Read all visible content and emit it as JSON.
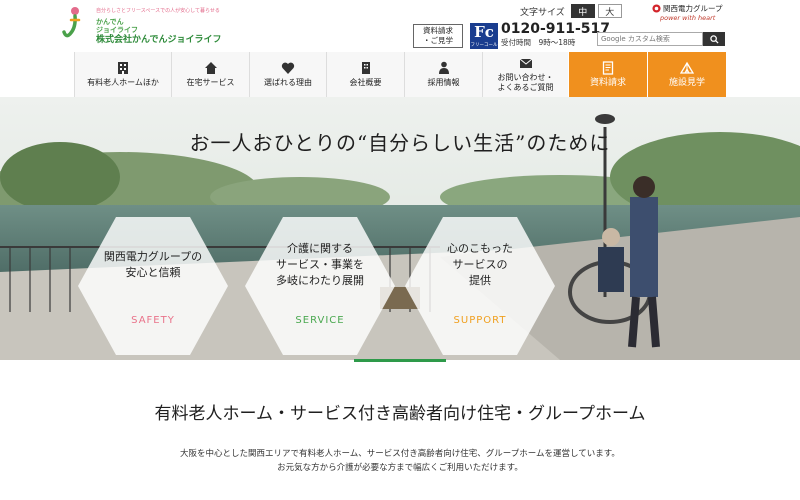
{
  "logo": {
    "tagline": "自分らしさとフリースペースでの人が安心して暮らせる",
    "brand": "かんでん\nジョイライフ",
    "company": "株式会社かんでんジョイライフ"
  },
  "font_size": {
    "label": "文字サイズ",
    "options": [
      "中",
      "大"
    ],
    "selected": "中"
  },
  "kepco": {
    "name": "関西電力グループ",
    "slogan": "power with heart"
  },
  "document_request_small": "資料請求\n・ご見学",
  "freecall": {
    "badge": "Fc",
    "badge_sub": "フリーコール",
    "number": "0120-911-517",
    "hours": "受付時間　9時～18時"
  },
  "search": {
    "placeholder": "Google カスタム検索",
    "button_icon": "search-icon"
  },
  "nav": [
    {
      "label": "有料老人ホームほか",
      "icon": "building-icon"
    },
    {
      "label": "在宅サービス",
      "icon": "home-icon"
    },
    {
      "label": "選ばれる理由",
      "icon": "heart-icon"
    },
    {
      "label": "会社概要",
      "icon": "office-icon"
    },
    {
      "label": "採用情報",
      "icon": "person-icon"
    },
    {
      "label": "お問い合わせ・\nよくあるご質問",
      "icon": "mail-icon"
    },
    {
      "label": "資料請求",
      "icon": "document-icon"
    },
    {
      "label": "施設見学",
      "icon": "tent-icon"
    }
  ],
  "hero": {
    "headline": "お一人おひとりの“自分らしい生活”のために",
    "hexagons": [
      {
        "text": "関西電力グループの\n安心と信頼",
        "en": "SAFETY",
        "color": "#e9738a"
      },
      {
        "text": "介護に関する\nサービス・事業を\n多岐にわたり展開",
        "en": "SERVICE",
        "color": "#4aa84f"
      },
      {
        "text": "心のこもった\nサービスの\n提供",
        "en": "SUPPORT",
        "color": "#f0a020"
      }
    ]
  },
  "intro": {
    "title": "有料老人ホーム・サービス付き高齢者向け住宅・グループホーム",
    "text": "大阪を中心とした関西エリアで有料老人ホーム、サービス付き高齢者向け住宅、グループホームを運営しています。\nお元気な方から介護が必要な方まで幅広くご利用いただけます。"
  },
  "colors": {
    "accent_orange": "#f0901e",
    "brand_green": "#2e8b3a",
    "freecall_blue": "#1a3d8f"
  }
}
